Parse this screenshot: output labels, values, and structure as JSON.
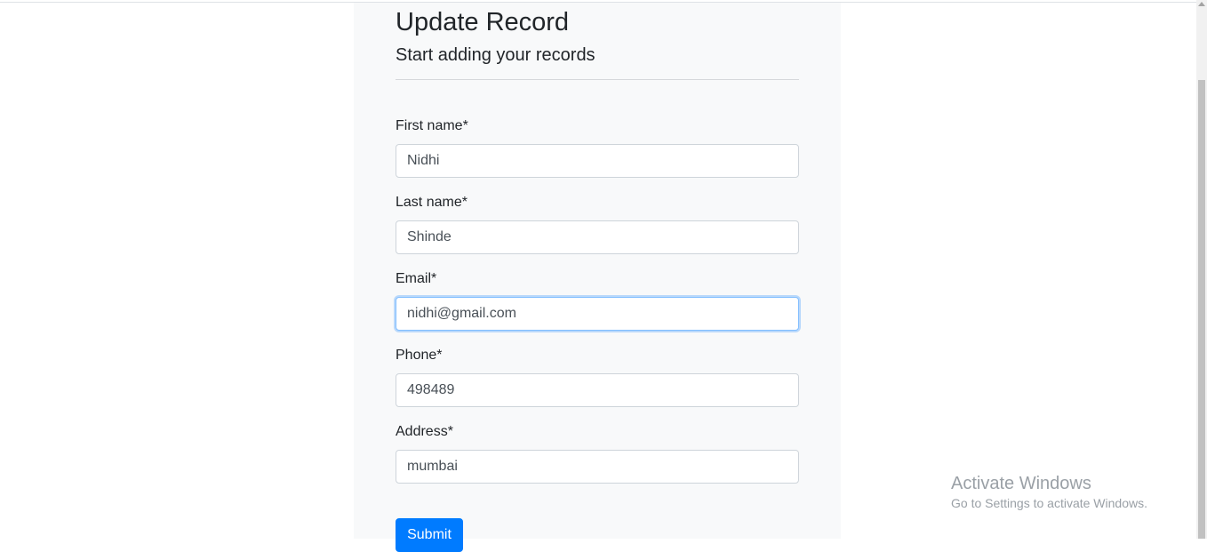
{
  "form": {
    "title": "Update Record",
    "subtitle": "Start adding your records",
    "fields": [
      {
        "label": "First name*",
        "value": "Nidhi"
      },
      {
        "label": "Last name*",
        "value": "Shinde"
      },
      {
        "label": "Email*",
        "value": "nidhi@gmail.com"
      },
      {
        "label": "Phone*",
        "value": "498489"
      },
      {
        "label": "Address*",
        "value": "mumbai"
      }
    ],
    "submit_label": "Submit"
  },
  "watermark": {
    "title": "Activate Windows",
    "subtitle": "Go to Settings to activate Windows."
  },
  "colors": {
    "accent": "#007bff",
    "panel_bg": "#f8f9fa",
    "focus_border": "#80bdff"
  }
}
